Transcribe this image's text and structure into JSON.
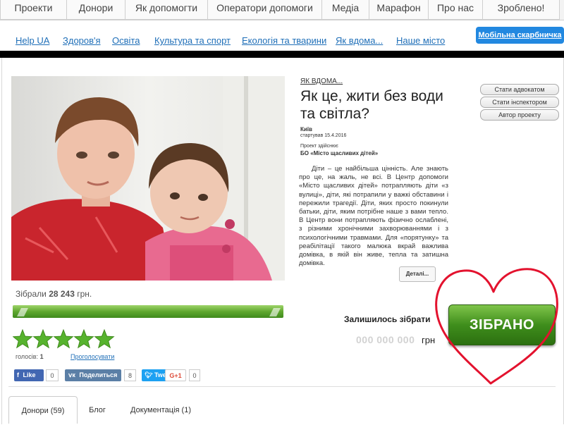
{
  "top_nav": [
    "Проекти",
    "Донори",
    "Як допомогти",
    "Оператори допомоги",
    "Медіа",
    "Марафон",
    "Про нас",
    "Зроблено!"
  ],
  "sub_nav": [
    "Help UA",
    "Здоров'я",
    "Освіта",
    "Культура та спорт",
    "Екологія та тварини",
    "Як вдома...",
    "Наше місто"
  ],
  "mobile_button": "Мобільна скарбничка",
  "project": {
    "category": "ЯК ВДОМА...",
    "title": "Як це, жити без води та світла?",
    "city": "Київ",
    "started": "стартував 15.4.2016",
    "implemented_by": "Проект здійснює",
    "org": "БО «Місто щасливих дітей»",
    "description": "Діти – це найбільша цінність. Але знають про це, на жаль, не всі. В Центр допомоги «Місто щасливих дітей» потрапляють діти «з вулиці», діти, які потрапили у важкі обставини і пережили трагедії. Діти, яких просто покинули батьки, діти, яким потрібне наше з вами тепло. В Центр вони потрапляють фізично ослаблені, з різними хронічними захворюваннями і з психологічними травмами. Для «порятунку» та реабілітації такого малюка вкрай важлива домівка, в якій він живе, тепла та затишна домівка.",
    "details_button": "Деталі..."
  },
  "side_buttons": [
    "Стати адвокатом",
    "Стати інспектором",
    "Автор проекту"
  ],
  "funding": {
    "collected_label": "Зібрали",
    "collected_amount": "28 243",
    "currency": "грн.",
    "progress": 1.0,
    "remain_label": "Залишилось зібрати",
    "remain_amount": "000 000 000",
    "remain_unit": "грн",
    "status_button": "ЗІБРАНО"
  },
  "rating": {
    "stars": 5,
    "votes_label": "голосів:",
    "votes_count": "1",
    "vote_link": "Проголосувати"
  },
  "social": {
    "facebook": {
      "label": "Like",
      "count": "0"
    },
    "vk": {
      "label": "Поделиться",
      "count": "8"
    },
    "twitter": {
      "label": "Twe",
      "count": ""
    },
    "gplus": {
      "label": "G+1",
      "count": "0"
    }
  },
  "bottom_tabs": [
    "Донори (59)",
    "Блог",
    "Документація (1)"
  ],
  "colors": {
    "link": "#1f6fb8",
    "accent_button": "#2288e0",
    "success_green": "#3f8e1c",
    "heart_red": "#e3122e",
    "star": "#57b32e"
  }
}
